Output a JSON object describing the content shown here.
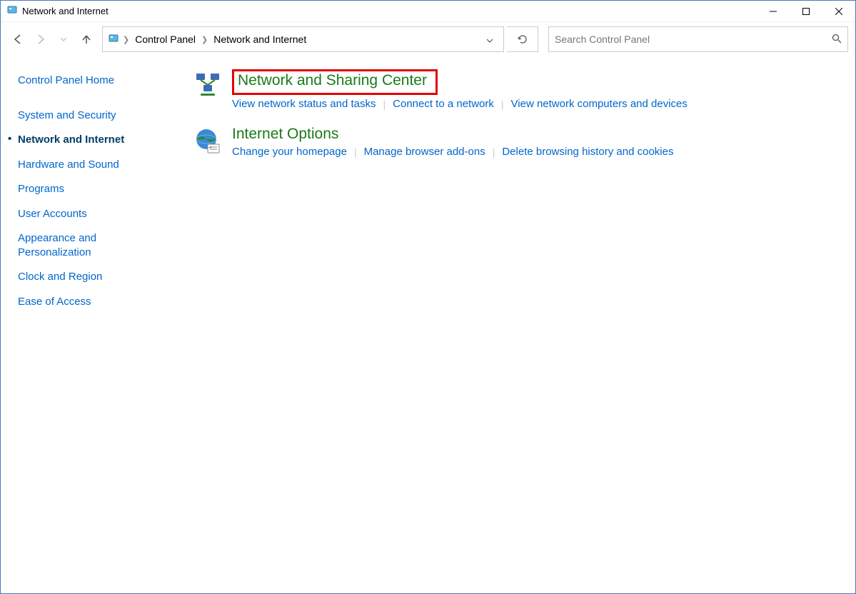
{
  "window": {
    "title": "Network and Internet"
  },
  "breadcrumb": {
    "root": "Control Panel",
    "current": "Network and Internet"
  },
  "search": {
    "placeholder": "Search Control Panel"
  },
  "sidebar": {
    "home": "Control Panel Home",
    "items": [
      {
        "label": "System and Security"
      },
      {
        "label": "Network and Internet"
      },
      {
        "label": "Hardware and Sound"
      },
      {
        "label": "Programs"
      },
      {
        "label": "User Accounts"
      },
      {
        "label": "Appearance and Personalization"
      },
      {
        "label": "Clock and Region"
      },
      {
        "label": "Ease of Access"
      }
    ]
  },
  "main": {
    "categories": [
      {
        "title": "Network and Sharing Center",
        "highlighted": true,
        "links": [
          "View network status and tasks",
          "Connect to a network",
          "View network computers and devices"
        ]
      },
      {
        "title": "Internet Options",
        "highlighted": false,
        "links": [
          "Change your homepage",
          "Manage browser add-ons",
          "Delete browsing history and cookies"
        ]
      }
    ]
  }
}
